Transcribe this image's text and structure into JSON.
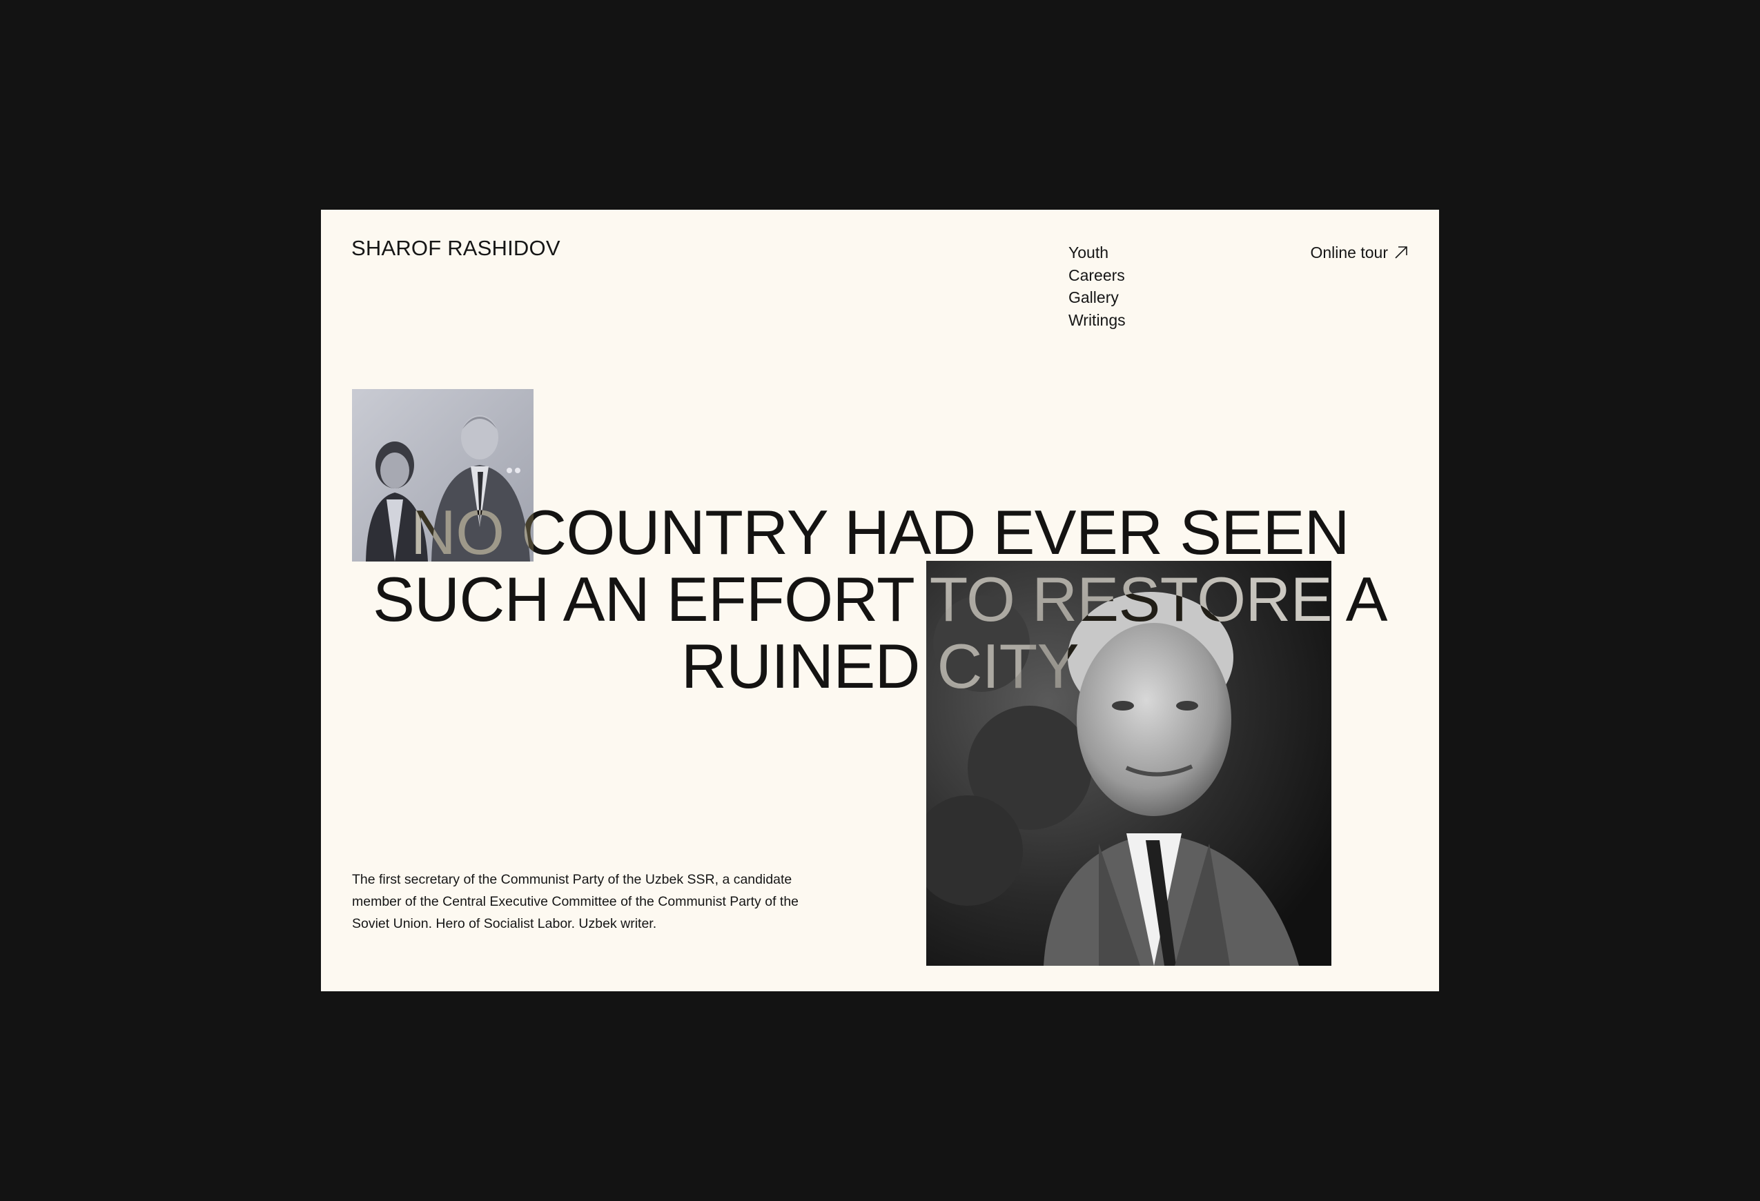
{
  "header": {
    "brand": "SHAROF RASHIDOV",
    "nav": [
      "Youth",
      "Careers",
      "Gallery",
      "Writings"
    ],
    "tour_label": "Online tour"
  },
  "hero": {
    "headline": [
      "NO COUNTRY HAD EVER SEEN",
      "SUCH AN EFFORT TO RESTORE A",
      "RUINED CITY"
    ],
    "description": "The first secretary of the Communist Party of the Uzbek SSR, a candidate member of the Central Executive Committee of the Communist Party of the Soviet Union. Hero of Socialist Labor. Uzbek writer."
  },
  "icons": {
    "tour": "arrow-up-right-icon"
  },
  "colors": {
    "page_background": "#131313",
    "frame_background": "#fdf9f1",
    "text": "#161616"
  }
}
